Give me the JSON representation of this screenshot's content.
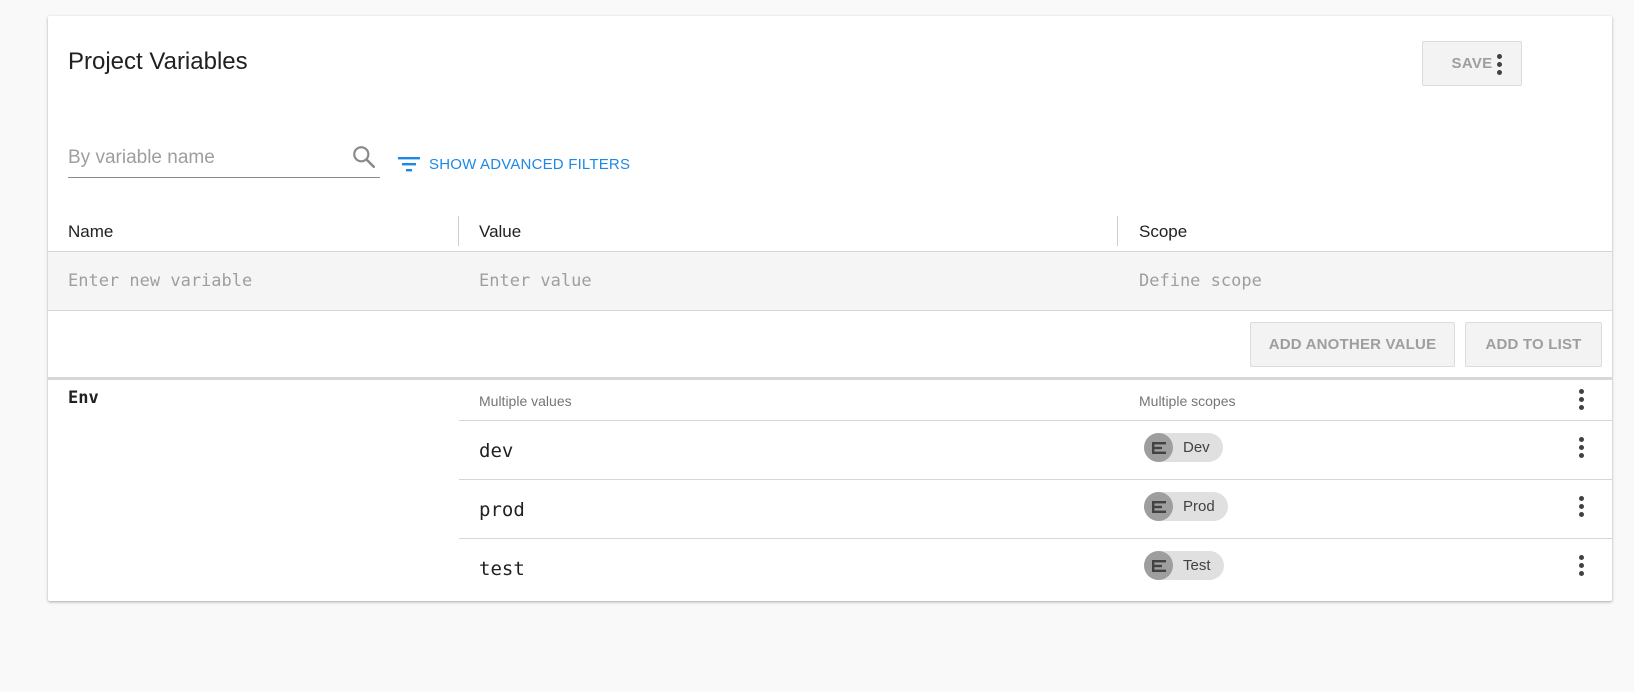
{
  "panel": {
    "title": "Project Variables",
    "save_label": "SAVE"
  },
  "search": {
    "placeholder": "By variable name",
    "value": ""
  },
  "filters": {
    "label": "SHOW ADVANCED FILTERS"
  },
  "table": {
    "columns": [
      "Name",
      "Value",
      "Scope"
    ]
  },
  "new_variable": {
    "name_placeholder": "Enter new variable",
    "value_placeholder": "Enter value",
    "scope_placeholder": "Define scope",
    "add_another_label": "ADD ANOTHER VALUE",
    "add_to_list_label": "ADD TO LIST"
  },
  "variables": [
    {
      "name": "Env",
      "values_header": "Multiple values",
      "scopes_header": "Multiple scopes",
      "rows": [
        {
          "value": "dev",
          "scope": "Dev"
        },
        {
          "value": "prod",
          "scope": "Prod"
        },
        {
          "value": "test",
          "scope": "Test"
        }
      ]
    }
  ],
  "icons": {
    "search": "search-icon",
    "filter": "filter-icon",
    "more": "more-vert-icon",
    "environment": "environment-icon"
  },
  "colors": {
    "accent": "#1e88e5",
    "chip_bg": "#e0e0e0",
    "chip_avatar": "#9e9e9e"
  }
}
